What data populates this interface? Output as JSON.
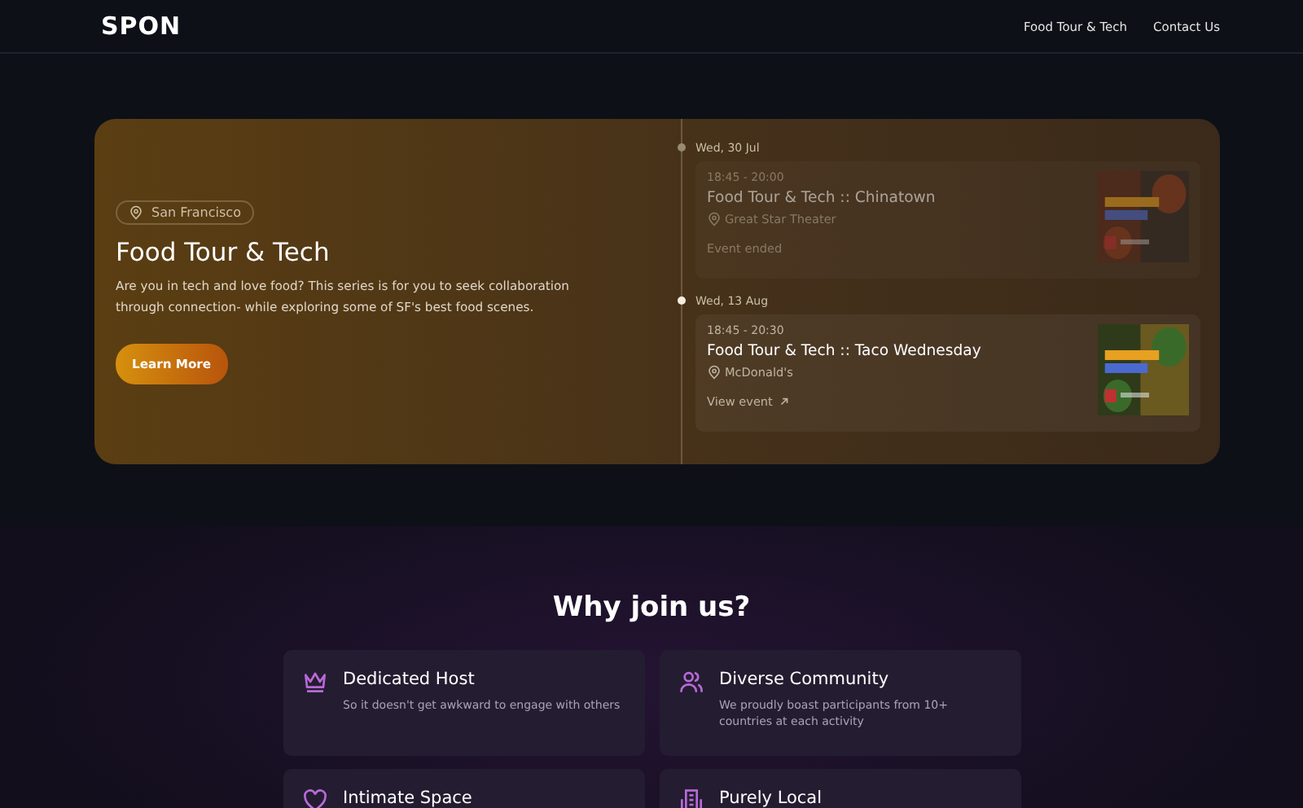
{
  "nav": {
    "logo": "SPON",
    "links": [
      "Food Tour & Tech",
      "Contact Us"
    ]
  },
  "hero": {
    "location": "San Francisco",
    "title": "Food Tour & Tech",
    "description": "Are you in tech and love food? This series is for you to seek collaboration through connection- while exploring some of SF's best food scenes.",
    "button": "Learn More",
    "events": [
      {
        "date": "Wed, 30 Jul",
        "time": "18:45 - 20:00",
        "title": "Food Tour & Tech :: Chinatown",
        "venue": "Great Star Theater",
        "ended": true,
        "status": "Event ended"
      },
      {
        "date": "Wed, 13 Aug",
        "time": "18:45 - 20:30",
        "title": "Food Tour & Tech :: Taco Wednesday",
        "venue": "McDonald's",
        "ended": false,
        "status": "View event"
      }
    ]
  },
  "why": {
    "title": "Why join us?",
    "features": [
      {
        "kind": "crown",
        "title": "Dedicated Host",
        "text": "So it doesn't get awkward to engage with others"
      },
      {
        "kind": "people",
        "title": "Diverse Community",
        "text": "We proudly boast participants from 10+ countries at each activity"
      },
      {
        "kind": "heart",
        "title": "Intimate Space"
      },
      {
        "kind": "building",
        "title": "Purely Local"
      }
    ]
  }
}
